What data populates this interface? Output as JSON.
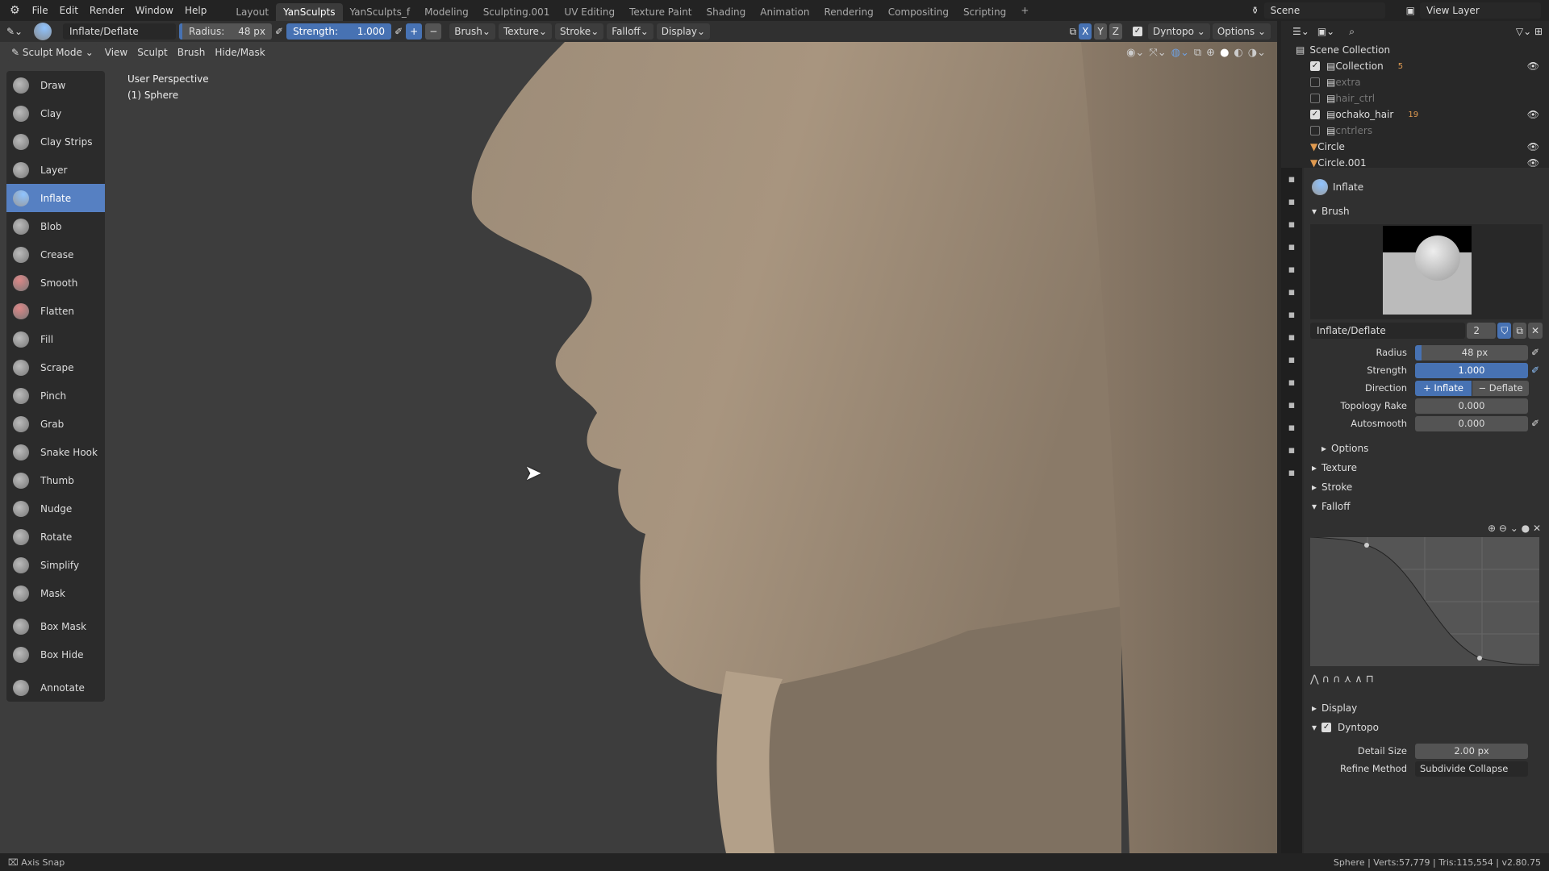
{
  "topbar": {
    "menus": [
      "File",
      "Edit",
      "Render",
      "Window",
      "Help"
    ],
    "workspaces": [
      "Layout",
      "YanSculpts",
      "YanSculpts_f",
      "Modeling",
      "Sculpting.001",
      "UV Editing",
      "Texture Paint",
      "Shading",
      "Animation",
      "Rendering",
      "Compositing",
      "Scripting"
    ],
    "active_workspace": "YanSculpts",
    "add_tab": "+",
    "scene": "Scene",
    "view_layer": "View Layer"
  },
  "toolheader": {
    "brush_name": "Inflate/Deflate",
    "radius_label": "Radius:",
    "radius_value": "48 px",
    "strength_label": "Strength:",
    "strength_value": "1.000",
    "plus": "+",
    "minus": "−",
    "dropdowns": [
      "Brush",
      "Texture",
      "Stroke",
      "Falloff",
      "Display"
    ],
    "axes": [
      "X",
      "Y",
      "Z"
    ],
    "dyntopo": "Dyntopo",
    "options": "Options"
  },
  "viewport": {
    "mode": "Sculpt Mode",
    "menus": [
      "View",
      "Sculpt",
      "Brush",
      "Hide/Mask"
    ],
    "overlay_line1": "User Perspective",
    "overlay_line2": "(1) Sphere"
  },
  "tools": [
    "Draw",
    "Clay",
    "Clay Strips",
    "Layer",
    "Inflate",
    "Blob",
    "Crease",
    "Smooth",
    "Flatten",
    "Fill",
    "Scrape",
    "Pinch",
    "Grab",
    "Snake Hook",
    "Thumb",
    "Nudge",
    "Rotate",
    "Simplify",
    "Mask",
    "Box Mask",
    "Box Hide",
    "Annotate"
  ],
  "active_tool": "Inflate",
  "outliner": {
    "root": "Scene Collection",
    "items": [
      {
        "name": "Collection",
        "checked": true,
        "badge": "5",
        "visible": true
      },
      {
        "name": "extra",
        "checked": false
      },
      {
        "name": "hair_ctrl",
        "checked": false
      },
      {
        "name": "ochako_hair",
        "checked": true,
        "badge": "19",
        "visible": true
      },
      {
        "name": "cntrlers",
        "checked": false
      },
      {
        "name": "Circle",
        "visible": true
      },
      {
        "name": "Circle.001",
        "visible": true
      }
    ]
  },
  "properties": {
    "brush_title": "Inflate",
    "brush_section": "Brush",
    "brush_name": "Inflate/Deflate",
    "users": "2",
    "radius_label": "Radius",
    "radius": "48 px",
    "strength_label": "Strength",
    "strength": "1.000",
    "direction_label": "Direction",
    "dir_inflate": "Inflate",
    "dir_deflate": "Deflate",
    "topology_label": "Topology Rake",
    "topology": "0.000",
    "autosmooth_label": "Autosmooth",
    "autosmooth": "0.000",
    "options": "Options",
    "texture": "Texture",
    "stroke": "Stroke",
    "falloff": "Falloff",
    "display": "Display",
    "dyntopo": "Dyntopo",
    "detail_label": "Detail Size",
    "detail": "2.00 px",
    "refine_label": "Refine Method",
    "refine": "Subdivide Collapse"
  },
  "status": {
    "left": "Axis Snap",
    "right": "Sphere | Verts:57,779 | Tris:115,554 | v2.80.75"
  },
  "colors": {
    "accent": "#4772b3",
    "active_tool": "#5680c2",
    "skin": "#b8a58e"
  }
}
